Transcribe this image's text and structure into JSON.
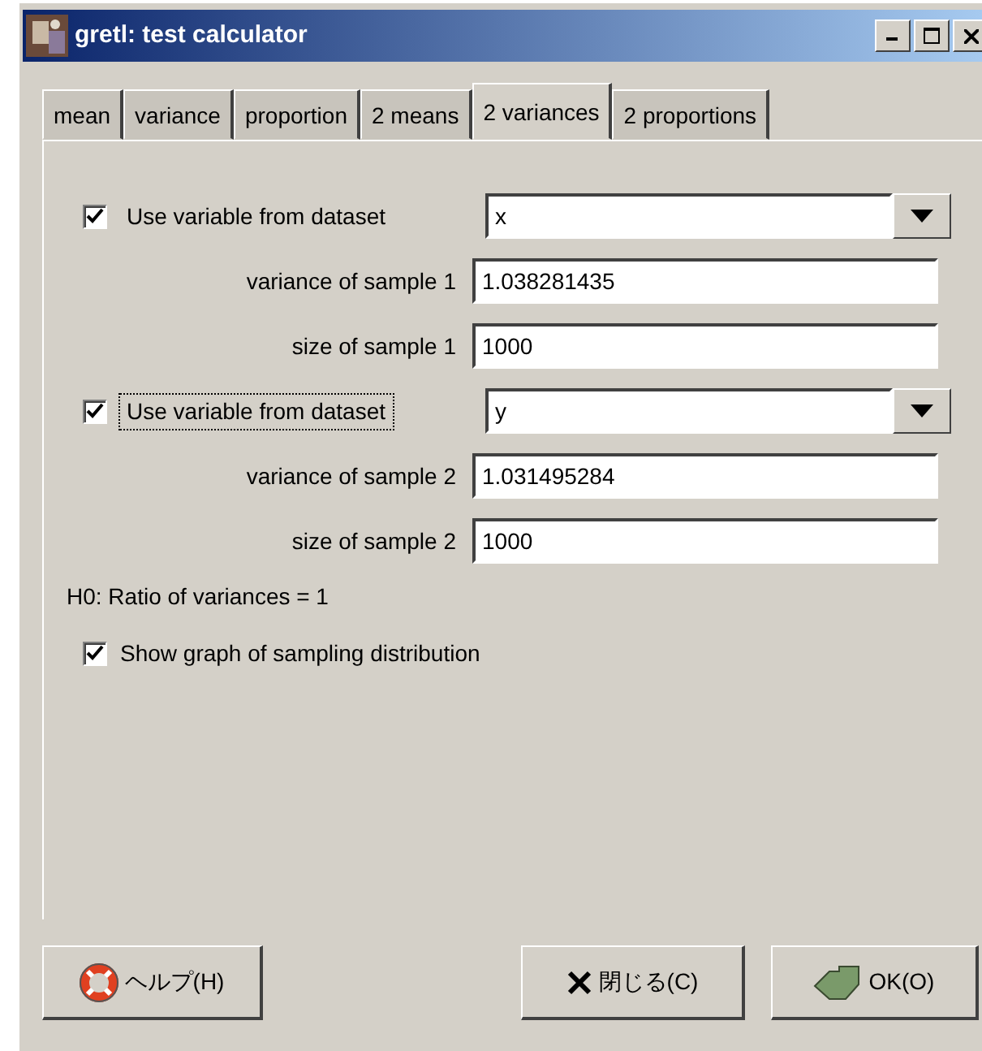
{
  "window": {
    "title": "gretl: test calculator"
  },
  "tabs": [
    {
      "label": "mean",
      "selected": false
    },
    {
      "label": "variance",
      "selected": false
    },
    {
      "label": "proportion",
      "selected": false
    },
    {
      "label": "2 means",
      "selected": false
    },
    {
      "label": "2 variances",
      "selected": true
    },
    {
      "label": "2 proportions",
      "selected": false
    }
  ],
  "rows": [
    {
      "kind": "combo",
      "label": "Use variable from dataset",
      "checked": true,
      "focused": false,
      "value": "x"
    },
    {
      "kind": "entry",
      "label": "variance of sample 1",
      "value": "1.038281435"
    },
    {
      "kind": "entry",
      "label": "size of sample 1",
      "value": "1000"
    },
    {
      "kind": "combo",
      "label": "Use variable from dataset",
      "checked": true,
      "focused": true,
      "value": "y"
    },
    {
      "kind": "entry",
      "label": "variance of sample 2",
      "value": "1.031495284"
    },
    {
      "kind": "entry",
      "label": "size of sample 2",
      "value": "1000"
    }
  ],
  "hypothesis": "H0: Ratio of variances = 1",
  "show_graph": {
    "label": "Show graph of sampling distribution",
    "checked": true
  },
  "buttons": [
    {
      "kind": "help",
      "label": "ヘルプ(H)"
    },
    {
      "kind": "close",
      "label": "閉じる(C)"
    },
    {
      "kind": "ok",
      "label": "OK(O)"
    }
  ]
}
